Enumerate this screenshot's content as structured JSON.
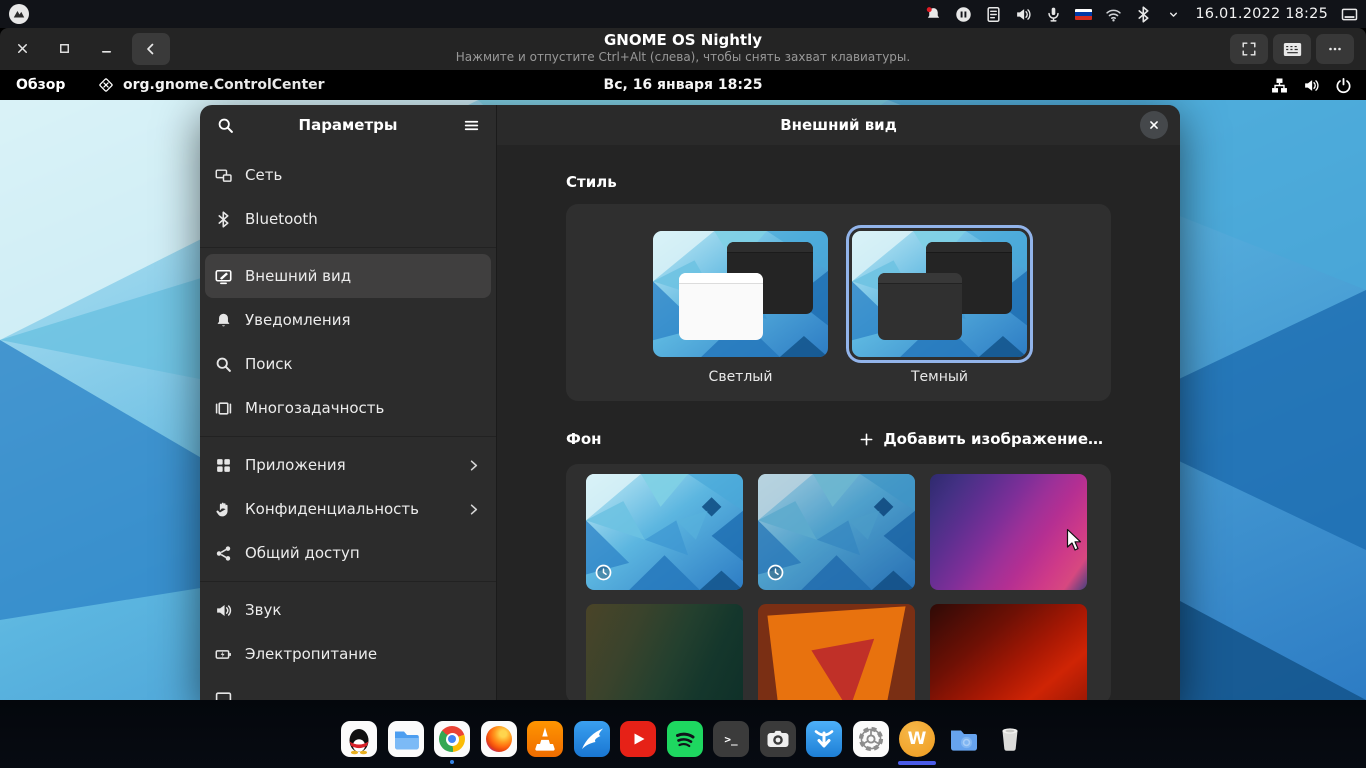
{
  "colors": {
    "accent": "#3584e4",
    "selection_ring": "#92b4ea",
    "dock_indicator": "#4a5ce8"
  },
  "host_bar": {
    "logo": "distro-logo",
    "icons": [
      "notification-bell",
      "pause-badge",
      "clipboard",
      "volume",
      "microphone",
      "ru-flag",
      "wifi",
      "bluetooth",
      "chevron-down"
    ],
    "clock": "16.01.2022 18:25",
    "tray_icon": "tray-window"
  },
  "vm_titlebar": {
    "title": "GNOME OS Nightly",
    "subtitle": "Нажмите и отпустите Ctrl+Alt (слева), чтобы снять захват клавиатуры.",
    "window_controls": [
      "close",
      "maximize",
      "minimize"
    ],
    "nav_back": "back",
    "actions": [
      "fullscreen",
      "keyboard",
      "menu"
    ]
  },
  "gnome_topbar": {
    "activities_label": "Обзор",
    "app_id": "org.gnome.ControlCenter",
    "clock": "Вс, 16 января 18:25",
    "status_icons": [
      "network-wired",
      "volume",
      "power"
    ]
  },
  "settings": {
    "sidebar": {
      "title": "Параметры",
      "groups": [
        [
          {
            "id": "network",
            "label": "Сеть",
            "icon": "network"
          },
          {
            "id": "bluetooth",
            "label": "Bluetooth",
            "icon": "bluetooth"
          }
        ],
        [
          {
            "id": "appearance",
            "label": "Внешний вид",
            "icon": "appearance",
            "selected": true
          },
          {
            "id": "notifications",
            "label": "Уведомления",
            "icon": "notifications"
          },
          {
            "id": "search",
            "label": "Поиск",
            "icon": "search"
          },
          {
            "id": "multitasking",
            "label": "Многозадачность",
            "icon": "multitasking"
          }
        ],
        [
          {
            "id": "apps",
            "label": "Приложения",
            "icon": "apps",
            "chevron": true
          },
          {
            "id": "privacy",
            "label": "Конфиденциальность",
            "icon": "privacy",
            "chevron": true
          },
          {
            "id": "sharing",
            "label": "Общий доступ",
            "icon": "share"
          }
        ],
        [
          {
            "id": "sound",
            "label": "Звук",
            "icon": "sound"
          },
          {
            "id": "power",
            "label": "Электропитание",
            "icon": "power"
          },
          {
            "id": "partial",
            "label": "",
            "icon": "display",
            "partial": true
          }
        ]
      ]
    },
    "panel": {
      "title": "Внешний вид",
      "style_section": {
        "heading": "Стиль",
        "options": [
          {
            "label": "Светлый",
            "variant": "light",
            "selected": false
          },
          {
            "label": "Темный",
            "variant": "dark",
            "selected": true
          }
        ]
      },
      "background_section": {
        "heading": "Фон",
        "add_button": "Добавить изображение…",
        "thumbnails": [
          {
            "kind": "gnome-blue",
            "badge": "clock"
          },
          {
            "kind": "gnome-blue-dark",
            "badge": "clock"
          },
          {
            "kind": "purple-waves"
          },
          {
            "kind": "green-dark"
          },
          {
            "kind": "orange-triangle"
          },
          {
            "kind": "red-dark"
          }
        ]
      }
    }
  },
  "dock": {
    "apps": [
      {
        "name": "qq"
      },
      {
        "name": "files"
      },
      {
        "name": "chrome",
        "indicator": "dot"
      },
      {
        "name": "firefox"
      },
      {
        "name": "vlc"
      },
      {
        "name": "bird-app"
      },
      {
        "name": "youtube"
      },
      {
        "name": "spotify"
      },
      {
        "name": "terminal"
      },
      {
        "name": "screenshot"
      },
      {
        "name": "downloader"
      },
      {
        "name": "settings-gear"
      },
      {
        "name": "wps-office",
        "indicator": "bar"
      },
      {
        "name": "cloud-folder"
      },
      {
        "name": "trash"
      }
    ]
  }
}
